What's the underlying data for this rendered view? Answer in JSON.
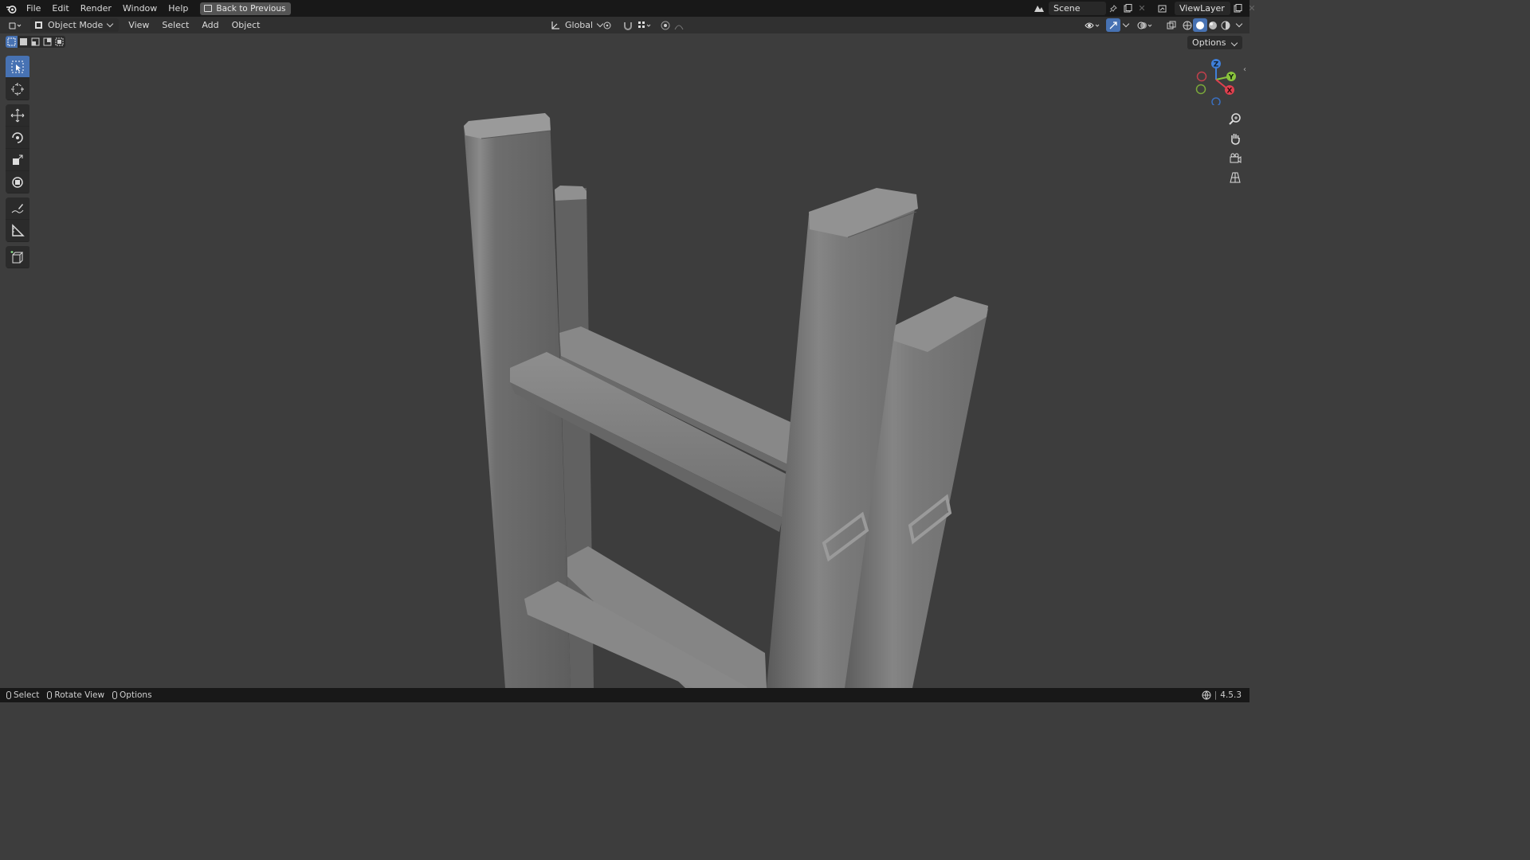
{
  "menu": {
    "items": [
      "File",
      "Edit",
      "Render",
      "Window",
      "Help"
    ],
    "back_label": "Back to Previous"
  },
  "scene": {
    "name": "Scene",
    "view_layer": "ViewLayer"
  },
  "header": {
    "mode": "Object Mode",
    "menus": [
      "View",
      "Select",
      "Add",
      "Object"
    ],
    "transform_orientation": "Global"
  },
  "viewport": {
    "options_label": "Options",
    "gizmo_axes": [
      "Z",
      "Y",
      "X"
    ]
  },
  "status": {
    "select": "Select",
    "rotate": "Rotate View",
    "options": "Options",
    "version": "4.5.3"
  },
  "colors": {
    "accent": "#4772b3",
    "axis_x": "#e0404f",
    "axis_y": "#8ac43c",
    "axis_z": "#3f7fd9"
  }
}
